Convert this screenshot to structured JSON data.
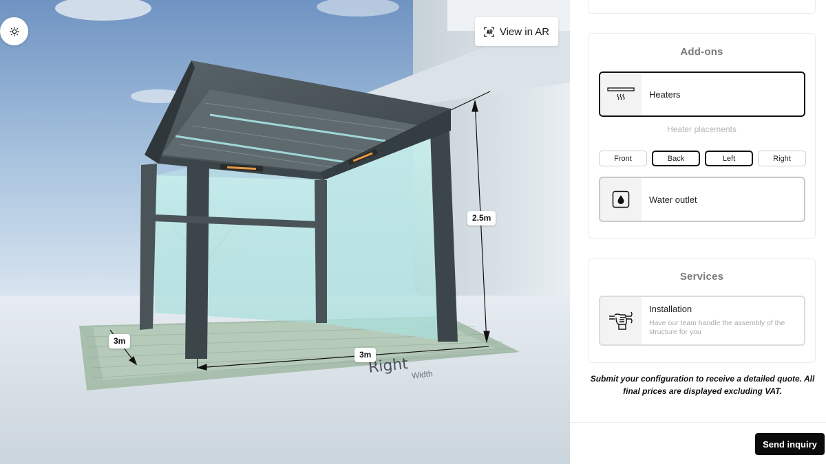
{
  "viewer": {
    "ar_label": "View in AR",
    "dimensions": {
      "height": "2.5m",
      "depth": "3m",
      "width": "3m"
    },
    "ground_labels": {
      "side_primary": "Right",
      "side_secondary": "Width"
    },
    "icons": {
      "theme": "sun-icon",
      "ar": "ar-scan-icon"
    }
  },
  "addons": {
    "title": "Add-ons",
    "heaters": {
      "label": "Heaters",
      "icon": "heater-icon",
      "selected": true
    },
    "placements": {
      "title": "Heater placements",
      "options": [
        {
          "label": "Front",
          "selected": false
        },
        {
          "label": "Back",
          "selected": true
        },
        {
          "label": "Left",
          "selected": true
        },
        {
          "label": "Right",
          "selected": false
        }
      ]
    },
    "water": {
      "label": "Water outlet",
      "icon": "water-drop-icon",
      "selected": false
    }
  },
  "services": {
    "title": "Services",
    "installation": {
      "label": "Installation",
      "description": "Have our team handle the assembly of the structure for you",
      "icon": "wrench-hand-icon"
    }
  },
  "note": "Submit your configuration to receive a detailed quote. All final prices are displayed excluding VAT.",
  "actions": {
    "send": "Send inquiry"
  },
  "colors": {
    "accent": "#0b0b0b",
    "frame": "#3c464a",
    "glass": "#bfe9e6",
    "sky": "#8fb0d6"
  }
}
